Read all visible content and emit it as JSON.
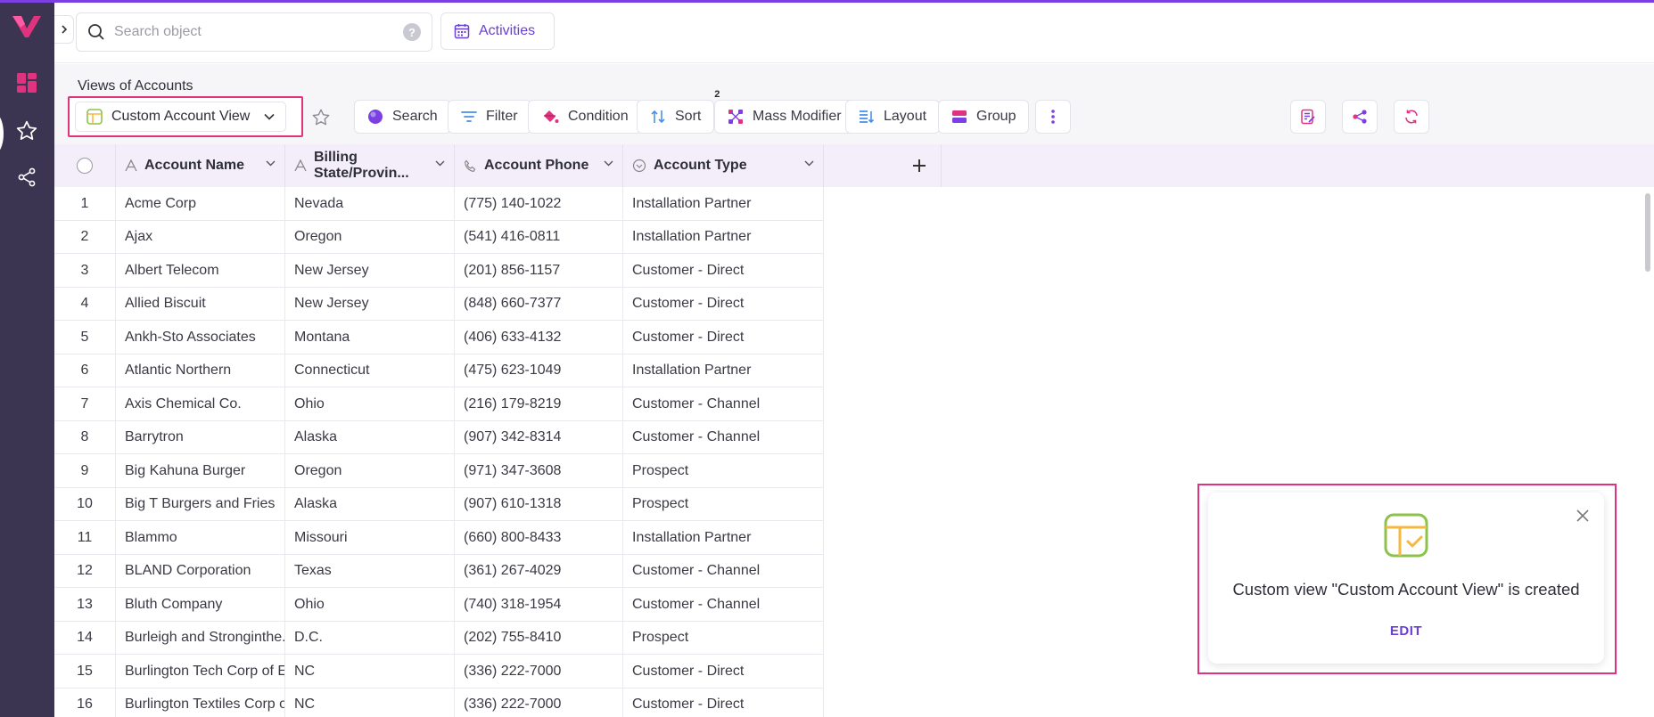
{
  "header": {
    "search_placeholder": "Search object",
    "help": "?",
    "activities_label": "Activities"
  },
  "views": {
    "title": "Views of Accounts",
    "selected_view": "Custom Account View"
  },
  "toolbar": {
    "search": "Search",
    "filter": "Filter",
    "condition": "Condition",
    "sort": "Sort",
    "sort_count": "2",
    "mass_modifier": "Mass Modifier",
    "layout": "Layout",
    "group": "Group"
  },
  "table": {
    "columns": [
      "Account Name",
      "Billing State/Provin...",
      "Account Phone",
      "Account Type"
    ],
    "rows": [
      {
        "n": "1",
        "name": "Acme Corp",
        "state": "Nevada",
        "phone": "(775) 140-1022",
        "type": "Installation Partner"
      },
      {
        "n": "2",
        "name": "Ajax",
        "state": "Oregon",
        "phone": "(541) 416-0811",
        "type": "Installation Partner"
      },
      {
        "n": "3",
        "name": "Albert Telecom",
        "state": "New Jersey",
        "phone": "(201) 856-1157",
        "type": "Customer - Direct"
      },
      {
        "n": "4",
        "name": "Allied Biscuit",
        "state": "New Jersey",
        "phone": "(848) 660-7377",
        "type": "Customer - Direct"
      },
      {
        "n": "5",
        "name": "Ankh-Sto Associates",
        "state": "Montana",
        "phone": "(406) 633-4132",
        "type": "Customer - Direct"
      },
      {
        "n": "6",
        "name": "Atlantic Northern",
        "state": "Connecticut",
        "phone": "(475) 623-1049",
        "type": "Installation Partner"
      },
      {
        "n": "7",
        "name": "Axis Chemical Co.",
        "state": "Ohio",
        "phone": "(216) 179-8219",
        "type": "Customer - Channel"
      },
      {
        "n": "8",
        "name": "Barrytron",
        "state": "Alaska",
        "phone": "(907) 342-8314",
        "type": "Customer - Channel"
      },
      {
        "n": "9",
        "name": "Big Kahuna Burger",
        "state": "Oregon",
        "phone": "(971) 347-3608",
        "type": "Prospect"
      },
      {
        "n": "10",
        "name": "Big T Burgers and Fries",
        "state": "Alaska",
        "phone": "(907) 610-1318",
        "type": "Prospect"
      },
      {
        "n": "11",
        "name": "Blammo",
        "state": "Missouri",
        "phone": "(660) 800-8433",
        "type": "Installation Partner"
      },
      {
        "n": "12",
        "name": "BLAND Corporation",
        "state": "Texas",
        "phone": "(361) 267-4029",
        "type": "Customer - Channel"
      },
      {
        "n": "13",
        "name": "Bluth Company",
        "state": "Ohio",
        "phone": "(740) 318-1954",
        "type": "Customer - Channel"
      },
      {
        "n": "14",
        "name": "Burleigh and Stronginthe...",
        "state": "D.C.",
        "phone": "(202) 755-8410",
        "type": "Prospect"
      },
      {
        "n": "15",
        "name": "Burlington Tech Corp of E...",
        "state": "NC",
        "phone": "(336) 222-7000",
        "type": "Customer - Direct"
      },
      {
        "n": "16",
        "name": "Burlington Textiles Corp of...",
        "state": "NC",
        "phone": "(336) 222-7000",
        "type": "Customer - Direct"
      }
    ]
  },
  "toast": {
    "message": "Custom view \"Custom Account View\" is created",
    "action": "EDIT"
  },
  "colors": {
    "accent": "#6a3fd4",
    "highlight": "#e0337f",
    "sidebar": "#3b3551"
  }
}
